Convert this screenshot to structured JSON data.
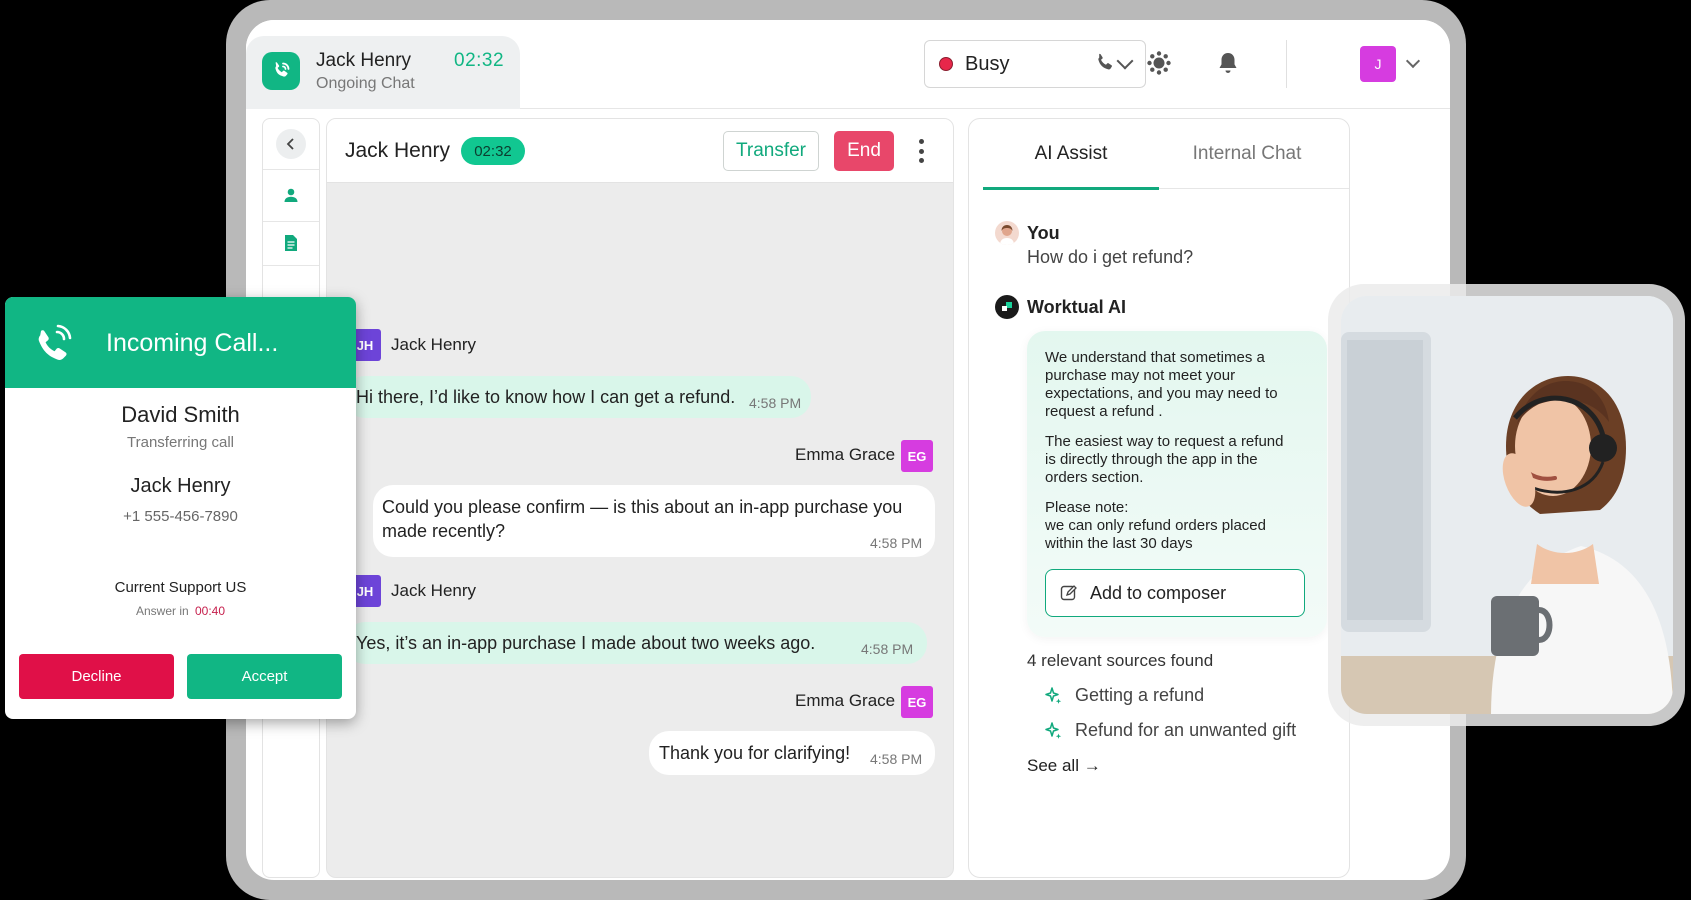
{
  "session_tab": {
    "name": "Jack Henry",
    "status": "Ongoing Chat",
    "timer": "02:32"
  },
  "topbar": {
    "status_label": "Busy",
    "status_color": "#e7274a",
    "user_initial": "J"
  },
  "chat": {
    "title": "Jack Henry",
    "timer": "02:32",
    "transfer_label": "Transfer",
    "end_label": "End",
    "messages": [
      {
        "sender": "Jack Henry",
        "initials": "JH",
        "text": "Hi there, I’d like to know how I can get a refund.",
        "time": "4:58 PM"
      },
      {
        "sender": "Emma Grace",
        "initials": "EG",
        "text": "Could you please confirm — is this about an in-app purchase you made recently?",
        "time": "4:58 PM"
      },
      {
        "sender": "Jack Henry",
        "initials": "JH",
        "text": "Yes, it’s an in-app purchase I made about two weeks ago.",
        "time": "4:58 PM"
      },
      {
        "sender": "Emma Grace",
        "initials": "EG",
        "text": "Thank you for clarifying!",
        "time": "4:58 PM"
      }
    ]
  },
  "assist": {
    "tabs": [
      "AI Assist",
      "Internal Chat"
    ],
    "you_label": "You",
    "you_question": "How do i get refund?",
    "ai_label": "Worktual AI",
    "ai_paragraph_1": "We understand that sometimes a purchase may not meet your expectations, and you may need to request a refund .",
    "ai_paragraph_2": "The easiest way to request a refund is directly through the app in the orders section.",
    "ai_paragraph_3": "Please note:\nwe can only refund orders placed within the last 30 days",
    "compose_label": "Add to composer",
    "sources_title": "4 relevant sources found",
    "sources": [
      "Getting a refund",
      "Refund for an unwanted gift"
    ],
    "see_all": "See all →"
  },
  "incoming_call": {
    "title": "Incoming Call...",
    "caller_name": "David Smith",
    "caller_status": "Transferring call",
    "contact_name": "Jack Henry",
    "contact_phone": "+1 555-456-7890",
    "queue": "Current Support US",
    "answer_prefix": "Answer in",
    "answer_timer": "00:40",
    "decline_label": "Decline",
    "accept_label": "Accept"
  },
  "colors": {
    "brand_green": "#11b684",
    "end_red": "#e8476a",
    "decline_red": "#e01048",
    "jh_badge": "#6d44d8",
    "eg_badge": "#d63ce0"
  }
}
